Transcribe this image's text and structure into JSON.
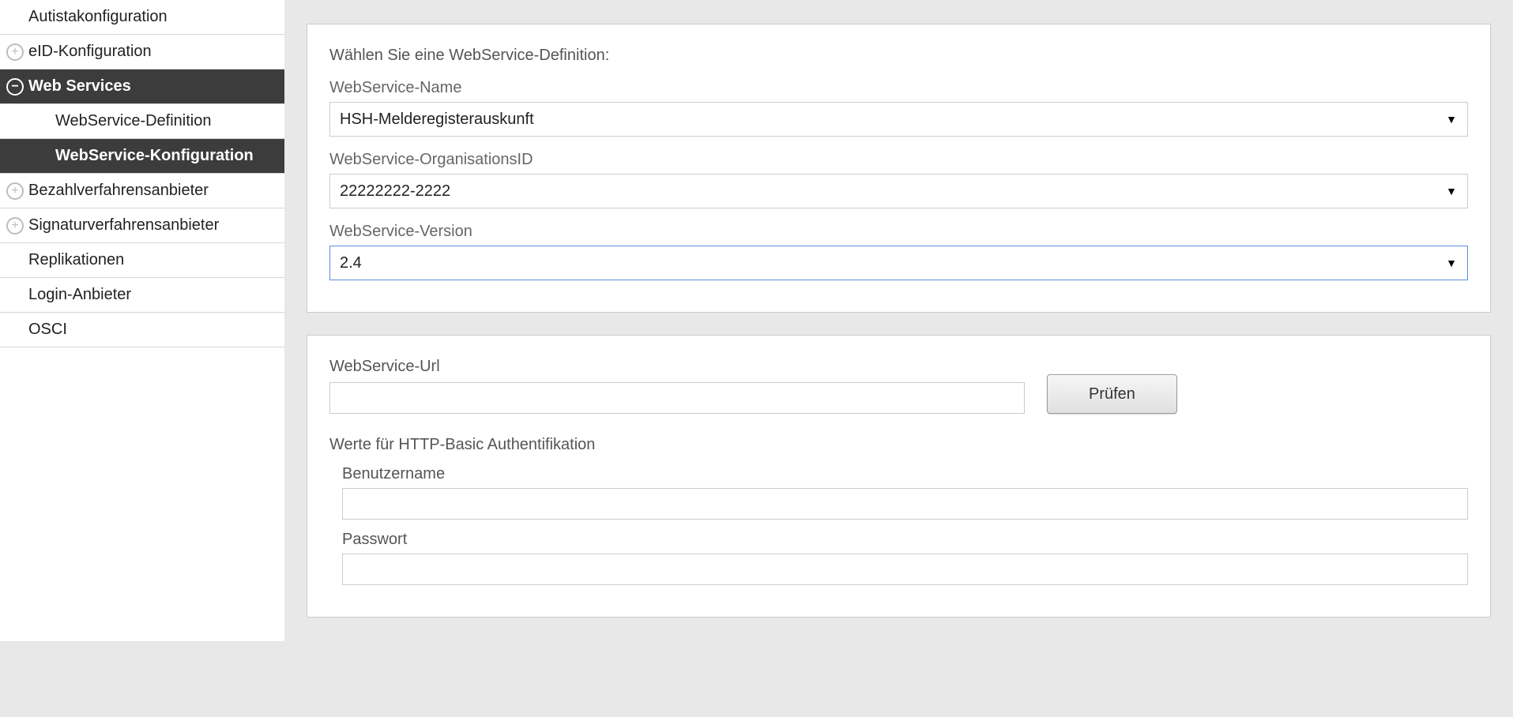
{
  "sidebar": {
    "items": [
      {
        "label": "Autistakonfiguration",
        "icon": null
      },
      {
        "label": "eID-Konfiguration",
        "icon": "plus"
      },
      {
        "label": "Web Services",
        "icon": "minus",
        "active": true
      },
      {
        "label": "WebService-Definition",
        "level": 1
      },
      {
        "label": "WebService-Konfiguration",
        "level": 1,
        "activeSub": true
      },
      {
        "label": "Bezahlverfahrensanbieter",
        "icon": "plus"
      },
      {
        "label": "Signaturverfahrensanbieter",
        "icon": "plus"
      },
      {
        "label": "Replikationen",
        "icon": null
      },
      {
        "label": "Login-Anbieter",
        "icon": null
      },
      {
        "label": "OSCI",
        "icon": null
      }
    ]
  },
  "main": {
    "panel1": {
      "heading": "Wählen Sie eine WebService-Definition:",
      "name_label": "WebService-Name",
      "name_value": "HSH-Melderegisterauskunft",
      "org_label": "WebService-OrganisationsID",
      "org_value": "22222222-2222",
      "version_label": "WebService-Version",
      "version_value": "2.4"
    },
    "panel2": {
      "url_label": "WebService-Url",
      "url_value": "",
      "check_button": "Prüfen",
      "auth_heading": "Werte für HTTP-Basic Authentifikation",
      "username_label": "Benutzername",
      "username_value": "",
      "password_label": "Passwort",
      "password_value": ""
    }
  }
}
